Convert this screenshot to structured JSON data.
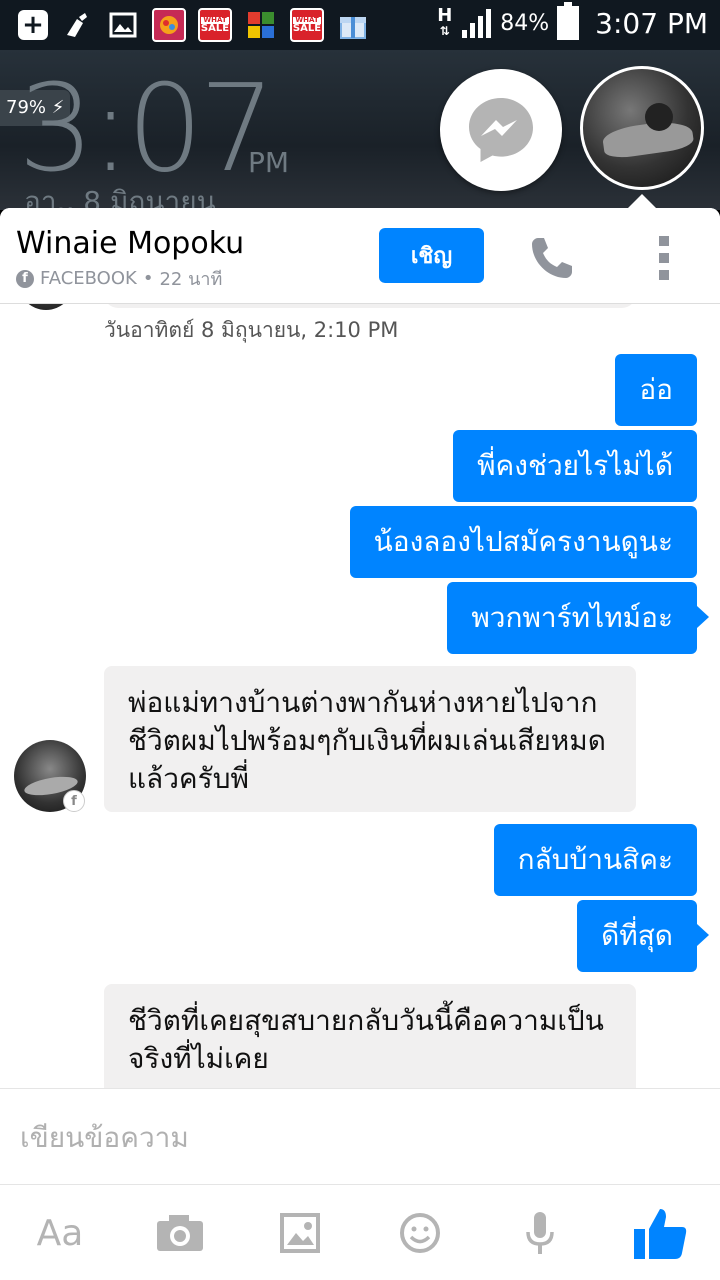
{
  "status_bar": {
    "signal_type": "H",
    "battery_percent": "84%",
    "time": "3:07 PM",
    "notification_icons": [
      "add-icon",
      "cleaner-icon",
      "gallery-icon",
      "candy-crush-icon",
      "sale-icon",
      "antivirus-icon",
      "sale-icon",
      "gift-icon"
    ]
  },
  "lockscreen": {
    "clock": "3:07",
    "ampm": "PM",
    "date": "อา., 8 มิถุนายน",
    "battery_widget": "79%"
  },
  "chat_header": {
    "name": "Winaie Mopoku",
    "source": "FACEBOOK",
    "time_ago": "22 นาที",
    "invite_label": "เชิญ"
  },
  "thread": {
    "timestamp": "วันอาทิตย์ 8 มิถุนายน, 2:10 PM",
    "out1": [
      "อ่อ",
      "พี่คงช่วยไรไม่ได้",
      "น้องลองไปสมัครงานดูนะ",
      "พวกพาร์ทไทม์อะ"
    ],
    "in1": "พ่อแม่ทางบ้านต่างพากันห่างหายไปจากชีวิตผมไปพร้อมๆกับเงินที่ผมเล่นเสียหมดแล้วครับพี่",
    "out2": [
      "กลับบ้านสิคะ",
      "ดีที่สุด"
    ],
    "in2": "ชีวิตที่เคยสุขสบายกลับวันนี้คือความเป็นจริงที่ไม่เคย"
  },
  "composer": {
    "placeholder": "เขียนข้อความ"
  },
  "toolbar": {
    "aa_label": "Aa"
  },
  "colors": {
    "accent": "#0084ff",
    "incoming_bubble": "#f1f0f0",
    "icon_gray": "#b4b4b4"
  }
}
